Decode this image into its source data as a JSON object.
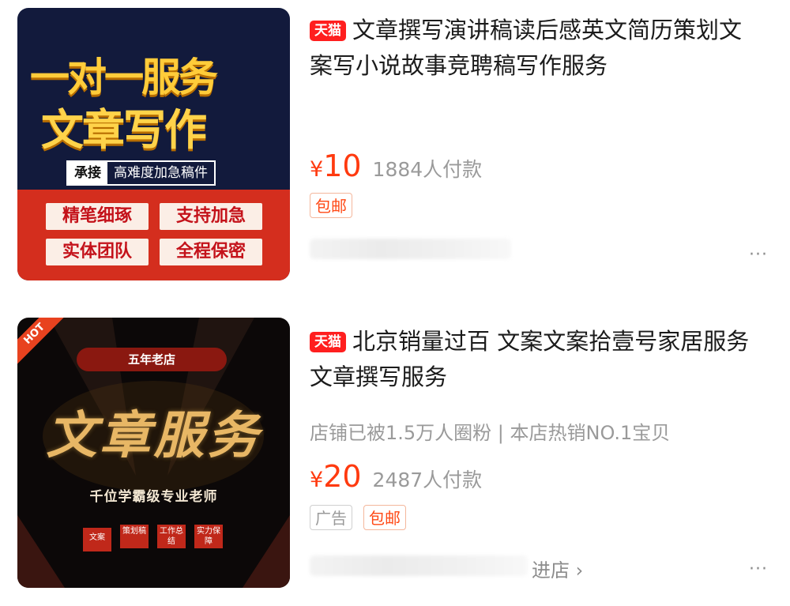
{
  "products": [
    {
      "badge": "天猫",
      "title": "文章撰写演讲稿读后感英文简历策划文案写小说故事竞聘稿写作服务",
      "price_symbol": "¥",
      "price": "10",
      "sales": "1884人付款",
      "tags": [
        "包邮"
      ],
      "more": "···",
      "thumbnail": {
        "line1": "一对一服务",
        "line2": "文章写作",
        "tag_a": "承接",
        "tag_b": "高难度加急稿件",
        "buttons": [
          "精笔细琢",
          "支持加急",
          "实体团队",
          "全程保密"
        ]
      }
    },
    {
      "badge": "天猫",
      "title": "北京销量过百 文案文案拾壹号家居服务 文章撰写服务",
      "shop_info": "店铺已被1.5万人圈粉 | 本店热销NO.1宝贝",
      "price_symbol": "¥",
      "price": "20",
      "sales": "2487人付款",
      "tags": [
        "广告",
        "包邮"
      ],
      "enter_shop": "进店 ›",
      "more": "···",
      "thumbnail": {
        "hot": "HOT",
        "pill": "五年老店",
        "title": "文章服务",
        "subtitle": "千位学霸级专业老师",
        "boxes": [
          "文案",
          "策划稿",
          "工作总结",
          "实力保障"
        ]
      }
    }
  ],
  "colors": {
    "price": "#ff3a0f",
    "tmall_badge": "#ff1f1f",
    "muted_text": "#9a9a9a"
  },
  "icons": [
    "more-icon",
    "chevron-right-icon"
  ]
}
